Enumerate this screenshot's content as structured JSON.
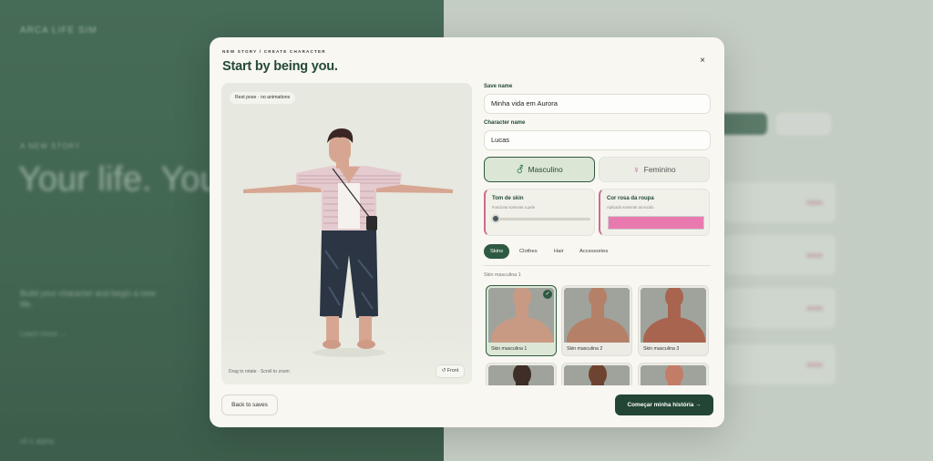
{
  "background": {
    "brand": "ARCA LIFE SIM",
    "eyebrow": "A NEW STORY",
    "hero": "Your life. Your next chapter.",
    "subtitle": "Build your character and begin a new life.",
    "link": "Learn more →",
    "footer": "v0.1 alpha"
  },
  "modal": {
    "eyebrow": "NEW STORY / CREATE CHARACTER",
    "title": "Start by being you.",
    "close_icon": "×"
  },
  "viewer": {
    "pose_chip": "Rest pose · no animations",
    "hint": "Drag to rotate · Scroll to zoom",
    "front_button": "↺ Front"
  },
  "form": {
    "save_name_label": "Save name",
    "save_name_value": "Minha vida em Aurora",
    "character_name_label": "Character name",
    "character_name_value": "Lucas"
  },
  "gender": {
    "male_label": "Masculino",
    "male_icon": "⚦",
    "female_label": "Feminino",
    "female_icon": "♀",
    "selected": "male"
  },
  "skin_tone": {
    "title": "Tom de skin",
    "subtitle": "Funciona somente a pele",
    "value": 0.0
  },
  "shirt_color": {
    "title": "Cor rosa da roupa",
    "subtitle": "Aplicado somente ao tecido",
    "color": "#e97ab0"
  },
  "tabs": [
    {
      "label": "Skins",
      "active": true
    },
    {
      "label": "Clothes",
      "active": false
    },
    {
      "label": "Hair",
      "active": false
    },
    {
      "label": "Accessories",
      "active": false
    }
  ],
  "skins_section": {
    "label": "Skin masculina 1",
    "items": [
      {
        "name": "Skin masculina 1",
        "selected": true,
        "tone": "#c99a83"
      },
      {
        "name": "Skin masculina 2",
        "selected": false,
        "tone": "#b58068"
      },
      {
        "name": "Skin masculina 3",
        "selected": false,
        "tone": "#a8644f"
      },
      {
        "name": "",
        "selected": false,
        "tone": "#3e2e27"
      },
      {
        "name": "",
        "selected": false,
        "tone": "#6e4430"
      },
      {
        "name": "",
        "selected": false,
        "tone": "#c37d66"
      }
    ]
  },
  "footer": {
    "back_label": "Back to saves",
    "start_label": "Começar minha história →"
  },
  "colors": {
    "brand_green": "#2f5a42",
    "dark_button": "#234535",
    "accent_pink": "#e97ab0"
  }
}
